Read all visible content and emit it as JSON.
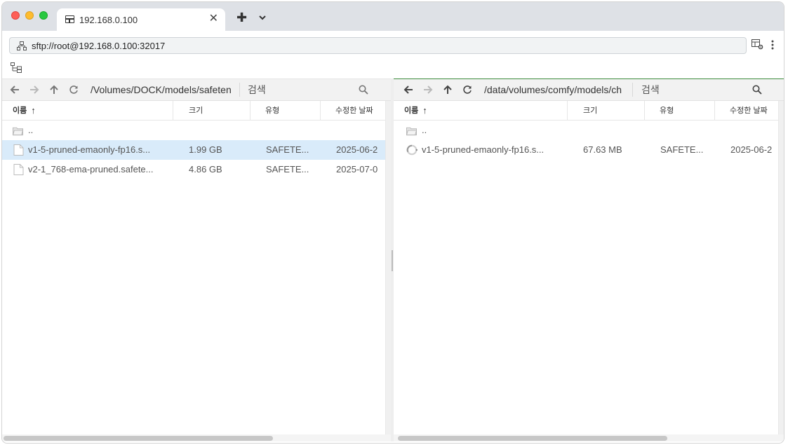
{
  "window": {
    "tab_title": "192.168.0.100",
    "tab_close": "✕",
    "tab_add": "✚",
    "address": "sftp://root@192.168.0.100:32017"
  },
  "icons": {
    "tab": "table-icon",
    "address": "network-icon",
    "tree": "tree-view-icon",
    "settings": "table-settings-icon",
    "menu": "kebab-menu-icon"
  },
  "columns": {
    "name": "이름",
    "size": "크기",
    "type": "유형",
    "modified": "수정한 날짜"
  },
  "left_pane": {
    "path": "/Volumes/DOCK/models/safeten",
    "search_placeholder": "검색",
    "rows": [
      {
        "name": "..",
        "size": "",
        "type": "",
        "modified": "",
        "kind": "folder"
      },
      {
        "name": "v1-5-pruned-emaonly-fp16.s...",
        "size": "1.99 GB",
        "type": "SAFETE...",
        "modified": "2025-06-2",
        "kind": "file",
        "selected": true
      },
      {
        "name": "v2-1_768-ema-pruned.safete...",
        "size": "4.86 GB",
        "type": "SAFETE...",
        "modified": "2025-07-0",
        "kind": "file"
      }
    ]
  },
  "right_pane": {
    "path": "/data/volumes/comfy/models/ch",
    "search_placeholder": "검색",
    "rows": [
      {
        "name": "..",
        "size": "",
        "type": "",
        "modified": "",
        "kind": "folder"
      },
      {
        "name": "v1-5-pruned-emaonly-fp16.s...",
        "size": "67.63 MB",
        "type": "SAFETE...",
        "modified": "2025-06-2",
        "kind": "transferring"
      }
    ]
  },
  "colors": {
    "titlebar": "#dee1e6",
    "selected_row": "#d9ebfa",
    "active_pane_border": "#3d8b3d"
  }
}
